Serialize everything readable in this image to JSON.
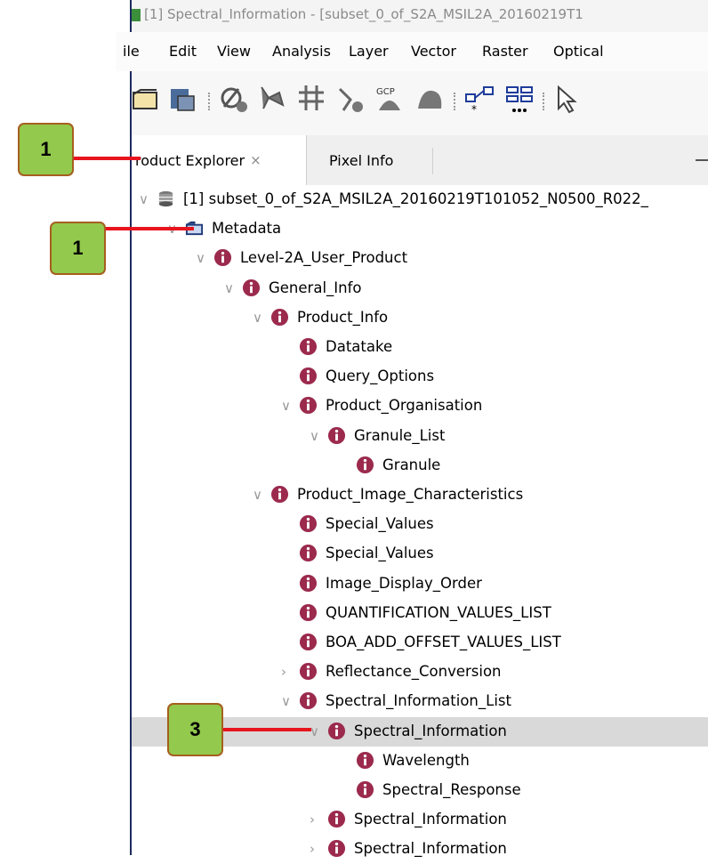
{
  "window": {
    "title": "[1] Spectral_Information - [subset_0_of_S2A_MSIL2A_20160219T1"
  },
  "menu": [
    "ile",
    "Edit",
    "View",
    "Analysis",
    "Layer",
    "Vector",
    "Raster",
    "Optical"
  ],
  "toolbar": {
    "icons": [
      "open-product-icon",
      "save-product-icon",
      "mask-icon",
      "pin-icon",
      "graticule-icon",
      "range-finder-icon",
      "gcp-icon",
      "overlay-icon",
      "graph-builder-icon",
      "batch-processing-icon",
      "select-tool-icon"
    ]
  },
  "tabs": {
    "product_explorer": "roduct Explorer",
    "close_glyph": "×",
    "pixel_info": "Pixel Info"
  },
  "tree": [
    {
      "label": "[1] subset_0_of_S2A_MSIL2A_20160219T101052_N0500_R022_",
      "icon": "product-icon",
      "chevron": "open",
      "selected": false
    },
    {
      "label": "Metadata",
      "icon": "folder-icon",
      "chevron": "open",
      "selected": false
    },
    {
      "label": "Level-2A_User_Product",
      "icon": "info-icon",
      "chevron": "open",
      "selected": false
    },
    {
      "label": "General_Info",
      "icon": "info-icon",
      "chevron": "open",
      "selected": false
    },
    {
      "label": "Product_Info",
      "icon": "info-icon",
      "chevron": "open",
      "selected": false
    },
    {
      "label": "Datatake",
      "icon": "info-icon",
      "chevron": "none",
      "selected": false
    },
    {
      "label": "Query_Options",
      "icon": "info-icon",
      "chevron": "none",
      "selected": false
    },
    {
      "label": "Product_Organisation",
      "icon": "info-icon",
      "chevron": "open",
      "selected": false
    },
    {
      "label": "Granule_List",
      "icon": "info-icon",
      "chevron": "open",
      "selected": false
    },
    {
      "label": "Granule",
      "icon": "info-icon",
      "chevron": "none",
      "selected": false
    },
    {
      "label": "Product_Image_Characteristics",
      "icon": "info-icon",
      "chevron": "open",
      "selected": false
    },
    {
      "label": "Special_Values",
      "icon": "info-icon",
      "chevron": "none",
      "selected": false
    },
    {
      "label": "Special_Values",
      "icon": "info-icon",
      "chevron": "none",
      "selected": false
    },
    {
      "label": "Image_Display_Order",
      "icon": "info-icon",
      "chevron": "none",
      "selected": false
    },
    {
      "label": "QUANTIFICATION_VALUES_LIST",
      "icon": "info-icon",
      "chevron": "none",
      "selected": false
    },
    {
      "label": "BOA_ADD_OFFSET_VALUES_LIST",
      "icon": "info-icon",
      "chevron": "none",
      "selected": false
    },
    {
      "label": "Reflectance_Conversion",
      "icon": "info-icon",
      "chevron": "closed",
      "selected": false
    },
    {
      "label": "Spectral_Information_List",
      "icon": "info-icon",
      "chevron": "open",
      "selected": false
    },
    {
      "label": "Spectral_Information",
      "icon": "info-icon",
      "chevron": "open",
      "selected": true
    },
    {
      "label": "Wavelength",
      "icon": "info-icon",
      "chevron": "none",
      "selected": false
    },
    {
      "label": "Spectral_Response",
      "icon": "info-icon",
      "chevron": "none",
      "selected": false
    },
    {
      "label": "Spectral_Information",
      "icon": "info-icon",
      "chevron": "closed",
      "selected": false
    },
    {
      "label": "Spectral_Information",
      "icon": "info-icon",
      "chevron": "closed",
      "selected": false
    }
  ],
  "callouts": [
    {
      "label": "1"
    },
    {
      "label": "1"
    },
    {
      "label": "3"
    }
  ],
  "colors": {
    "callout_fill": "#93c94d",
    "callout_border": "#a65f1f",
    "callout_line": "#e8141e",
    "info_icon": "#9b2a4d",
    "selection": "#d9d9d9"
  }
}
